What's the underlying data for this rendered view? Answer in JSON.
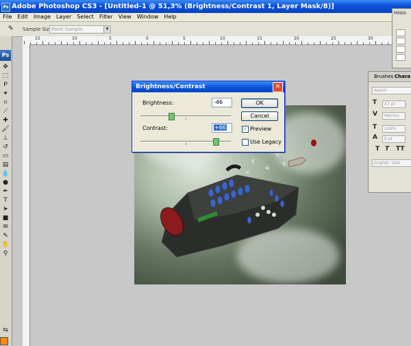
{
  "window": {
    "title": "Adobe Photoshop CS3 - [Untitled-1 @ 51,3% (Brightness/Contrast 1, Layer Mask/8)]"
  },
  "menu": [
    "File",
    "Edit",
    "Image",
    "Layer",
    "Select",
    "Filter",
    "View",
    "Window",
    "Help"
  ],
  "options": {
    "sample_size_label": "Sample Size:",
    "sample_size_value": "Point Sample"
  },
  "ruler": {
    "labels": [
      "15",
      "10",
      "5",
      "0",
      "5",
      "10",
      "15",
      "20",
      "25",
      "30"
    ]
  },
  "tools": {
    "logo": "Ps"
  },
  "dialog": {
    "title": "Brightness/Contrast",
    "brightness_label": "Brightness:",
    "brightness_value": "-46",
    "contrast_label": "Contrast:",
    "contrast_value": "+66",
    "ok_label": "OK",
    "cancel_label": "Cancel",
    "preview_label": "Preview",
    "preview_checked": true,
    "legacy_label": "Use Legacy",
    "legacy_checked": false
  },
  "history_panel": {
    "tab": "Histo"
  },
  "character_panel": {
    "tabs": [
      "Brushes",
      "Chara"
    ],
    "font": "Avenir",
    "size": "47 pt",
    "kerning": "Metrics",
    "scale": "100%",
    "baseline": "0 pt",
    "language": "English: USA"
  },
  "colors": {
    "foreground": "#ff8c00",
    "title_bar": "#0b4fd6",
    "dialog_bg": "#ece9d8"
  }
}
